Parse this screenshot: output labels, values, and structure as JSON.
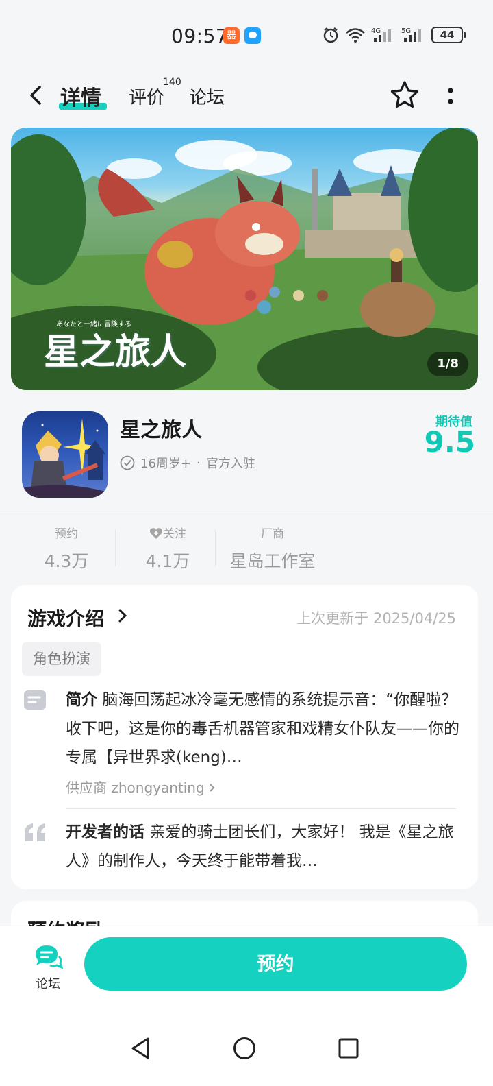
{
  "status_bar": {
    "time": "09:57",
    "app1_glyph": "器",
    "network": "4G 5G",
    "battery": "44"
  },
  "nav": {
    "tabs": [
      {
        "label": "详情",
        "active": true
      },
      {
        "label": "评价",
        "count": "140"
      },
      {
        "label": "论坛"
      }
    ]
  },
  "banner": {
    "counter": "1/8",
    "logo_title": "星之旅人",
    "logo_subtitle": "あなたと一緒に冒険する"
  },
  "app": {
    "name": "星之旅人",
    "age_rating": "16周岁+",
    "separator": "·",
    "official": "官方入驻",
    "expectation_label": "期待值",
    "expectation_value": "9.5"
  },
  "stats": [
    {
      "label": "预约",
      "value": "4.3万"
    },
    {
      "label": "关注",
      "value": "4.1万"
    },
    {
      "label": "厂商",
      "value": "星岛工作室"
    }
  ],
  "intro": {
    "title": "游戏介绍",
    "updated": "上次更新于 2025/04/25",
    "genre": "角色扮演",
    "summary_label": "简介",
    "summary": "脑海回荡起冰冷毫无感情的系统提示音：“你醒啦？收下吧，这是你的毒舌机器管家和戏精女仆队友——你的专属【异世界求(keng)…",
    "supplier": "供应商 zhongyanting",
    "dev_label": "开发者的话",
    "dev_text": "亲爱的骑士团长们，大家好！ 我是《星之旅人》的制作人，今天终于能带着我…"
  },
  "next_card": {
    "title": "预约奖励"
  },
  "bottom": {
    "forum_label": "论坛",
    "reserve_label": "预约"
  },
  "colors": {
    "accent": "#15d1bf",
    "expect": "#10c8b4",
    "background": "#f5f6f8"
  }
}
